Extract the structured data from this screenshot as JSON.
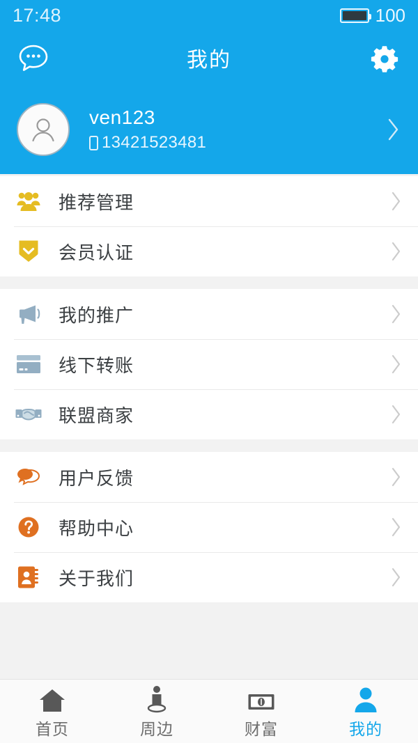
{
  "status_bar": {
    "time": "17:48",
    "battery_level": "100"
  },
  "header": {
    "title": "我的",
    "left_icon": "chat-bubble-icon",
    "right_icon": "gear-icon"
  },
  "profile": {
    "name": "ven123",
    "phone": "13421523481",
    "avatar_icon": "person-avatar-icon",
    "chevron": "chevron-right-icon"
  },
  "groups": [
    {
      "id": "group-membership",
      "items": [
        {
          "label": "推荐管理",
          "icon": "users-group-icon",
          "color": "#e5bc22"
        },
        {
          "label": "会员认证",
          "icon": "shield-check-icon",
          "color": "#e5bc22"
        }
      ]
    },
    {
      "id": "group-business",
      "items": [
        {
          "label": "我的推广",
          "icon": "megaphone-icon",
          "color": "#93aec2"
        },
        {
          "label": "线下转账",
          "icon": "credit-card-icon",
          "color": "#93aec2"
        },
        {
          "label": "联盟商家",
          "icon": "handshake-icon",
          "color": "#93aec2"
        }
      ]
    },
    {
      "id": "group-support",
      "items": [
        {
          "label": "用户反馈",
          "icon": "speech-bubbles-icon",
          "color": "#df7021"
        },
        {
          "label": "帮助中心",
          "icon": "question-circle-icon",
          "color": "#df7021"
        },
        {
          "label": "关于我们",
          "icon": "address-book-icon",
          "color": "#df7021"
        }
      ]
    }
  ],
  "tabbar": {
    "active_index": 3,
    "tabs": [
      {
        "label": "首页",
        "icon": "home-icon"
      },
      {
        "label": "周边",
        "icon": "nearby-person-icon"
      },
      {
        "label": "财富",
        "icon": "banknote-icon"
      },
      {
        "label": "我的",
        "icon": "profile-person-icon"
      }
    ]
  },
  "colors": {
    "brand_blue": "#14a7ea",
    "yellow": "#e5bc22",
    "steel_blue": "#93aec2",
    "orange": "#df7021",
    "text_dark": "#3c4043",
    "tab_inactive": "#6d6d6d",
    "divider": "#e9e9e9",
    "page_bg": "#f2f2f2"
  }
}
